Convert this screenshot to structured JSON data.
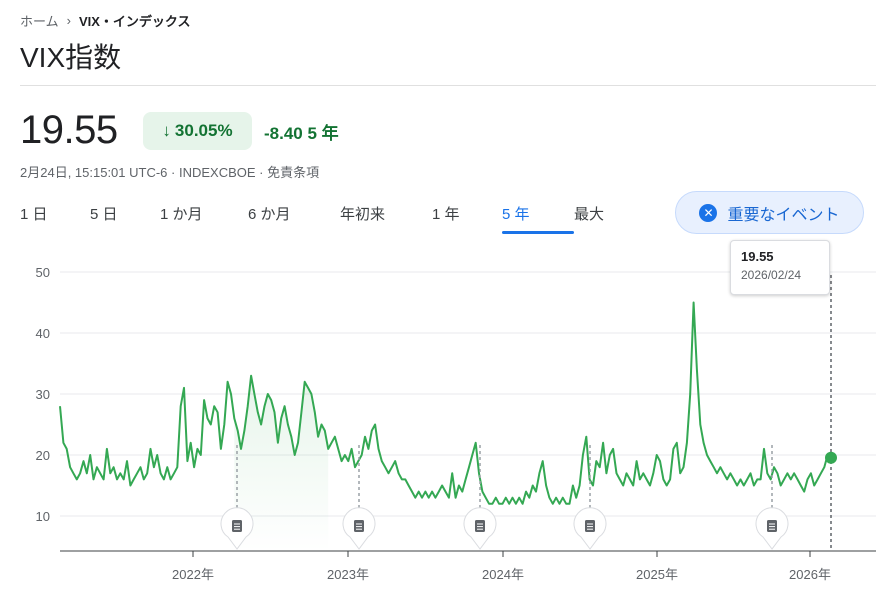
{
  "breadcrumb": {
    "home": "ホーム",
    "current": "VIX・インデックス"
  },
  "title": "VIX指数",
  "quote": {
    "price": "19.55",
    "change_pct": "30.05%",
    "change_abs": "-8.40",
    "period": "5 年",
    "meta": "2月24日, 15:15:01 UTC-6 · INDEXCBOE · 免責条項"
  },
  "tabs": [
    {
      "label": "1 日",
      "active": false
    },
    {
      "label": "5 日",
      "active": false
    },
    {
      "label": "1 か月",
      "active": false
    },
    {
      "label": "6 か月",
      "active": false
    },
    {
      "label": "年初来",
      "active": false
    },
    {
      "label": "1 年",
      "active": false
    },
    {
      "label": "5 年",
      "active": true
    },
    {
      "label": "最大",
      "active": false
    }
  ],
  "events_button": {
    "label": "重要なイベント",
    "icon": "close-circle-icon"
  },
  "tooltip": {
    "value": "19.55",
    "date": "2026/02/24"
  },
  "colors": {
    "line": "#34a853",
    "accent": "#1a73e8",
    "positive_bg": "#e6f4ea",
    "positive_text": "#137333"
  },
  "chart_data": {
    "type": "line",
    "x_range": [
      "2021-02-24",
      "2026-02-24"
    ],
    "ylim": [
      5,
      55
    ],
    "yticks": [
      10,
      20,
      30,
      40,
      50
    ],
    "xticks": [
      "2022年",
      "2023年",
      "2024年",
      "2025年",
      "2026年"
    ],
    "grid": true,
    "series": [
      {
        "values": [
          28,
          22,
          21,
          18,
          17,
          16,
          17,
          19,
          17,
          20,
          16,
          18,
          17,
          16,
          21,
          17,
          18,
          16,
          17,
          16,
          19,
          15,
          16,
          17,
          18,
          16,
          17,
          21,
          18,
          20,
          17,
          16,
          18,
          16,
          17,
          18,
          28,
          31,
          19,
          22,
          18,
          21,
          20,
          29,
          26,
          25,
          28,
          27,
          21,
          25,
          32,
          30,
          26,
          24,
          21,
          24,
          28,
          33,
          30,
          27,
          25,
          28,
          30,
          29,
          27,
          22,
          26,
          28,
          25,
          23,
          20,
          22,
          27,
          32,
          31,
          30,
          27,
          23,
          25,
          24,
          21,
          22,
          23,
          21,
          19,
          20,
          19,
          21,
          18,
          19,
          20,
          23,
          21,
          24,
          25,
          21,
          19,
          18,
          17,
          18,
          19,
          17,
          16,
          16,
          15,
          14,
          13,
          14,
          13,
          14,
          13,
          14,
          13,
          14,
          15,
          14,
          13,
          17,
          13,
          15,
          14,
          16,
          18,
          20,
          22,
          17,
          14,
          13,
          12,
          12,
          13,
          12,
          12,
          13,
          12,
          13,
          12,
          13,
          12,
          14,
          13,
          15,
          14,
          17,
          19,
          15,
          13,
          12,
          13,
          12,
          13,
          12,
          12,
          15,
          13,
          15,
          20,
          23,
          16,
          15,
          19,
          18,
          22,
          17,
          20,
          21,
          17,
          16,
          15,
          17,
          16,
          15,
          19,
          16,
          17,
          16,
          15,
          17,
          20,
          19,
          16,
          15,
          16,
          21,
          22,
          17,
          18,
          22,
          30,
          45,
          34,
          25,
          22,
          20,
          19,
          18,
          17,
          18,
          17,
          16,
          17,
          16,
          15,
          16,
          15,
          16,
          17,
          15,
          16,
          16,
          21,
          17,
          16,
          18,
          17,
          15,
          16,
          17,
          16,
          17,
          16,
          15,
          14,
          16,
          17,
          15,
          16,
          17,
          18,
          20,
          19.55
        ]
      }
    ],
    "events": [
      "2022-05",
      "2023-01",
      "2023-10",
      "2024-08",
      "2025-10"
    ]
  }
}
